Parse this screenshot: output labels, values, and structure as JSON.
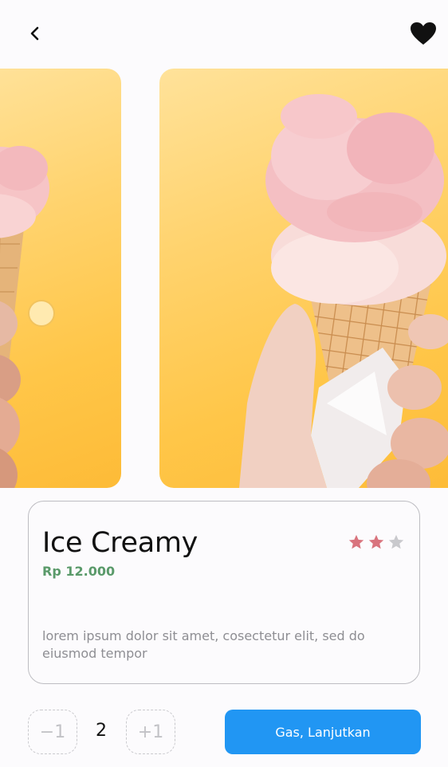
{
  "header": {
    "back_icon": "chevron-left-icon",
    "favorite_icon": "heart-icon"
  },
  "carousel": {
    "images": [
      {
        "subject": "ice-cream-cone"
      },
      {
        "subject": "ice-cream-cone"
      }
    ],
    "dot_color": "#ffeab0"
  },
  "product": {
    "title": "Ice Creamy",
    "price": "Rp 12.000",
    "rating": {
      "value": 2,
      "max": 3
    },
    "description": "lorem ipsum dolor sit amet, cosectetur elit, sed do eiusmod tempor"
  },
  "quantity": {
    "minus_label": "−1",
    "value": "2",
    "plus_label": "+1"
  },
  "actions": {
    "continue_label": "Gas, Lanjutkan"
  },
  "colors": {
    "accent": "#2196f3",
    "price": "#5a9a6a",
    "star_active": "#d9747e",
    "star_inactive": "#c9c9cd",
    "image_bg": "#ffc648"
  }
}
